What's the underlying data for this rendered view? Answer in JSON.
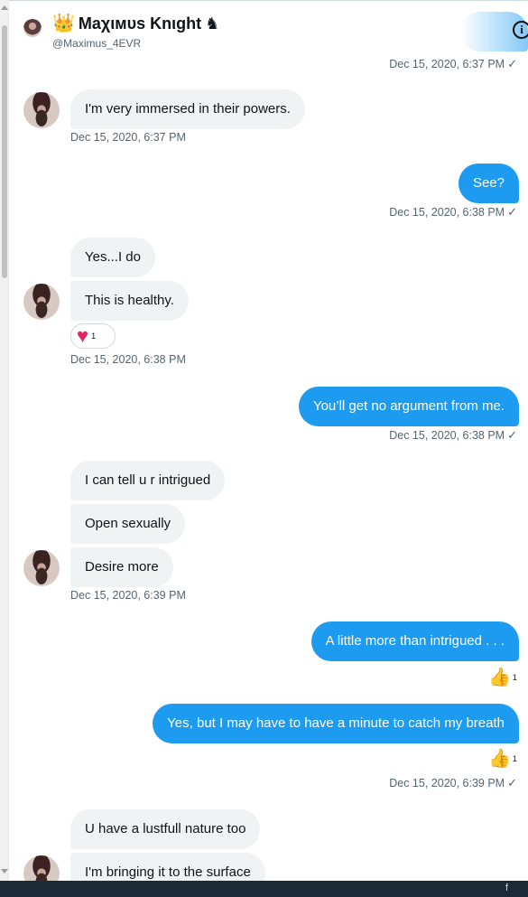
{
  "header": {
    "name": "Maχιмυs Knιght",
    "handle": "@Maximus_4EVR",
    "crown": "👑",
    "knight": "♞",
    "info": "i"
  },
  "messages": {
    "ts0": "Dec 15, 2020, 6:37 PM",
    "m1": "I'm very immersed in their powers.",
    "ts1": "Dec 15, 2020, 6:37 PM",
    "m2": "See?",
    "ts2": "Dec 15, 2020, 6:38 PM",
    "m3": "Yes...I do",
    "m4": "This is healthy.",
    "m4_reaction_count": "1",
    "ts3": "Dec 15, 2020, 6:38 PM",
    "m5": "You’ll get no argument from me.",
    "ts4": "Dec 15, 2020, 6:38 PM",
    "m6": "I can tell u r intrigued",
    "m7": "Open sexually",
    "m8": "Desire more",
    "ts5": "Dec 15, 2020, 6:39 PM",
    "m9": "A little more than intrigued . . .",
    "m9_reaction_count": "1",
    "m10": "Yes, but I may have to have a minute to catch my breath",
    "m10_reaction_count": "1",
    "ts6": "Dec 15, 2020, 6:39 PM",
    "m11": "U have a lustfull nature too",
    "m12": "I'm bringing it to the surface"
  },
  "icons": {
    "heart": "♥",
    "thumbs_up": "👍",
    "check": "✓"
  },
  "colors": {
    "sent_bubble": "#1d9bf0",
    "received_bubble": "#eff3f4",
    "timestamp": "#536471",
    "heart": "#e0245e"
  }
}
